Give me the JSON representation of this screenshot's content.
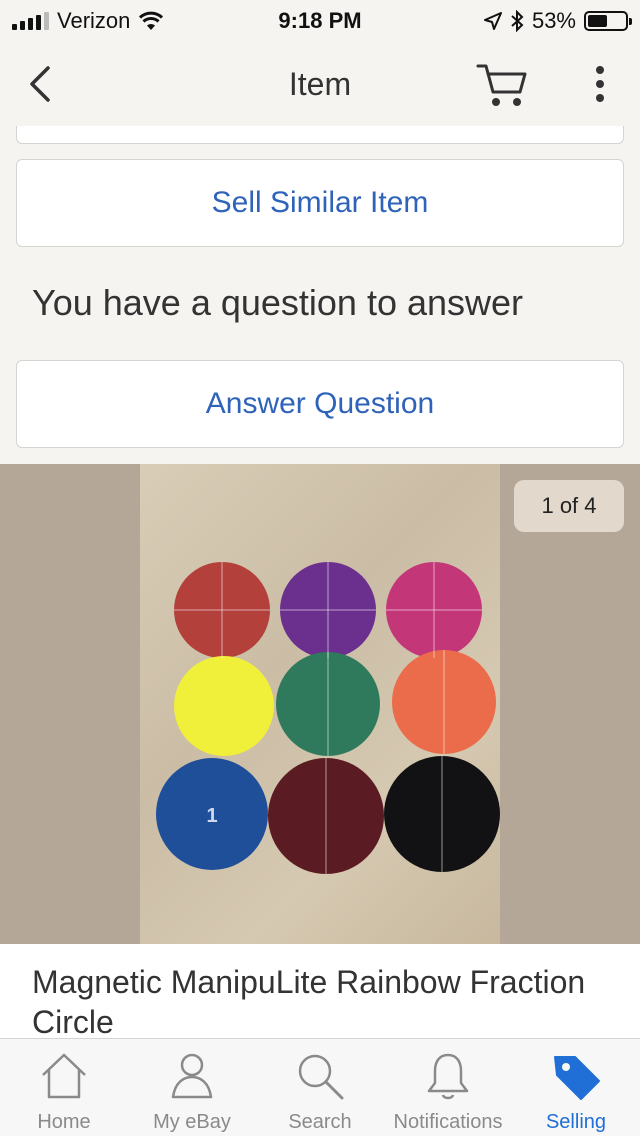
{
  "status_bar": {
    "carrier": "Verizon",
    "time": "9:18 PM",
    "battery": "53%",
    "battery_level": 0.53
  },
  "nav": {
    "title": "Item"
  },
  "actions": {
    "sell_similar_label": "Sell Similar Item",
    "question_prompt": "You have a question to answer",
    "answer_question_label": "Answer Question"
  },
  "gallery": {
    "counter": "1 of 4"
  },
  "listing": {
    "title": "Magnetic ManipuLite Rainbow Fraction Circle"
  },
  "tabs": [
    {
      "label": "Home",
      "icon": "home-icon"
    },
    {
      "label": "My eBay",
      "icon": "person-icon"
    },
    {
      "label": "Search",
      "icon": "search-icon"
    },
    {
      "label": "Notifications",
      "icon": "bell-icon"
    },
    {
      "label": "Selling",
      "icon": "tag-icon",
      "active": true
    }
  ],
  "colors": {
    "accent": "#2e63b9",
    "active_tab": "#1f6fd6",
    "background": "#f5f4f1"
  }
}
